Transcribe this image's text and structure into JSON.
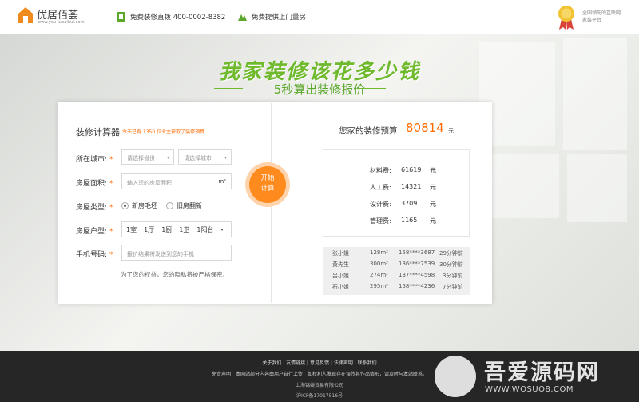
{
  "header": {
    "logo_name": "优居佰荟",
    "logo_url": "www.you-jubaihui.com",
    "hotline": "免费装修直拨 400-0002-8382",
    "onsite": "免费提供上门量房",
    "slogan": "全国领先的互联网家装平台"
  },
  "hero": {
    "headline": "我家装修该花多少钱",
    "subline": "5秒算出装修报价"
  },
  "calculator": {
    "title": "装修计算器",
    "count_text": "今天已有 1350 位业主获取了装修预算",
    "city_label": "所在城市:",
    "province_placeholder": "请选择省份",
    "city_placeholder": "请选择城市",
    "area_label": "房屋面积:",
    "area_placeholder": "输入您的房屋面积",
    "area_unit": "m²",
    "type_label": "房屋类型:",
    "type_options": [
      "新房毛坯",
      "旧房翻新"
    ],
    "layout_label": "房屋户型:",
    "layout_options": [
      "1室",
      "1厅",
      "1厨",
      "1卫",
      "1阳台"
    ],
    "phone_label": "手机号码:",
    "phone_placeholder": "报价结果将发送到您的手机",
    "privacy": "为了您的权益，您的隐私将被严格保密。",
    "start_line1": "开始",
    "start_line2": "计算"
  },
  "result": {
    "label": "您家的装修预算",
    "value": "80814",
    "unit": "元",
    "costs": [
      {
        "name": "材料费:",
        "value": "61619",
        "unit": "元"
      },
      {
        "name": "人工费:",
        "value": "14321",
        "unit": "元"
      },
      {
        "name": "设计费:",
        "value": "3709",
        "unit": "元"
      },
      {
        "name": "管理费:",
        "value": "1165",
        "unit": "元"
      }
    ],
    "feed": [
      {
        "name": "张小姐",
        "area": "128m²",
        "phone": "158****3687",
        "time": "29分钟前"
      },
      {
        "name": "黄先生",
        "area": "300m²",
        "phone": "136****7539",
        "time": "30分钟前"
      },
      {
        "name": "吕小姐",
        "area": "274m²",
        "phone": "137****4598",
        "time": "3分钟前"
      },
      {
        "name": "石小姐",
        "area": "295m²",
        "phone": "158****4236",
        "time": "7分钟前"
      }
    ]
  },
  "footer": {
    "links": "关于我们 | 友情链接 | 意见反馈 | 法律声明 | 联系我们",
    "disclaimer": "免责声明：本网站部分内容由用户自行上传，如权利人发现存在误传其作品情形，请及时与本站联系。",
    "company": "上海锦婵贸易有限公司",
    "icp": "沪ICP备17017516号"
  },
  "watermark": {
    "text": "吾爱源码网",
    "url": "WWW.WOSUO8.COM"
  },
  "colors": {
    "brand_green": "#6fba2c",
    "accent_orange": "#ff6a00",
    "footer_bg": "#262626"
  }
}
